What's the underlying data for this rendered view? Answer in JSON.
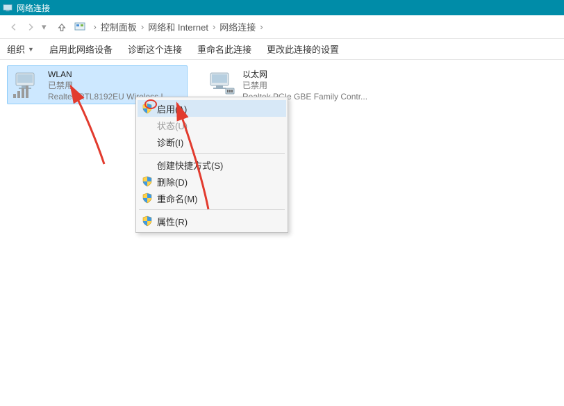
{
  "window": {
    "title": "网络连接"
  },
  "breadcrumb": {
    "crumbs": [
      "控制面板",
      "网络和 Internet",
      "网络连接"
    ]
  },
  "commandbar": {
    "organize": "组织",
    "enable": "启用此网络设备",
    "diagnose": "诊断这个连接",
    "rename": "重命名此连接",
    "change_settings": "更改此连接的设置"
  },
  "adapters": {
    "wlan": {
      "name": "WLAN",
      "status": "已禁用",
      "device": "Realtek RTL8192EU Wireless L..."
    },
    "ethernet": {
      "name": "以太网",
      "status": "已禁用",
      "device": "Realtek PCIe GBE Family Contr..."
    }
  },
  "context_menu": {
    "enable": "启用(A)",
    "status": "状态(U)",
    "diagnose": "诊断(I)",
    "create_shortcut": "创建快捷方式(S)",
    "delete": "删除(D)",
    "rename": "重命名(M)",
    "properties": "属性(R)"
  }
}
